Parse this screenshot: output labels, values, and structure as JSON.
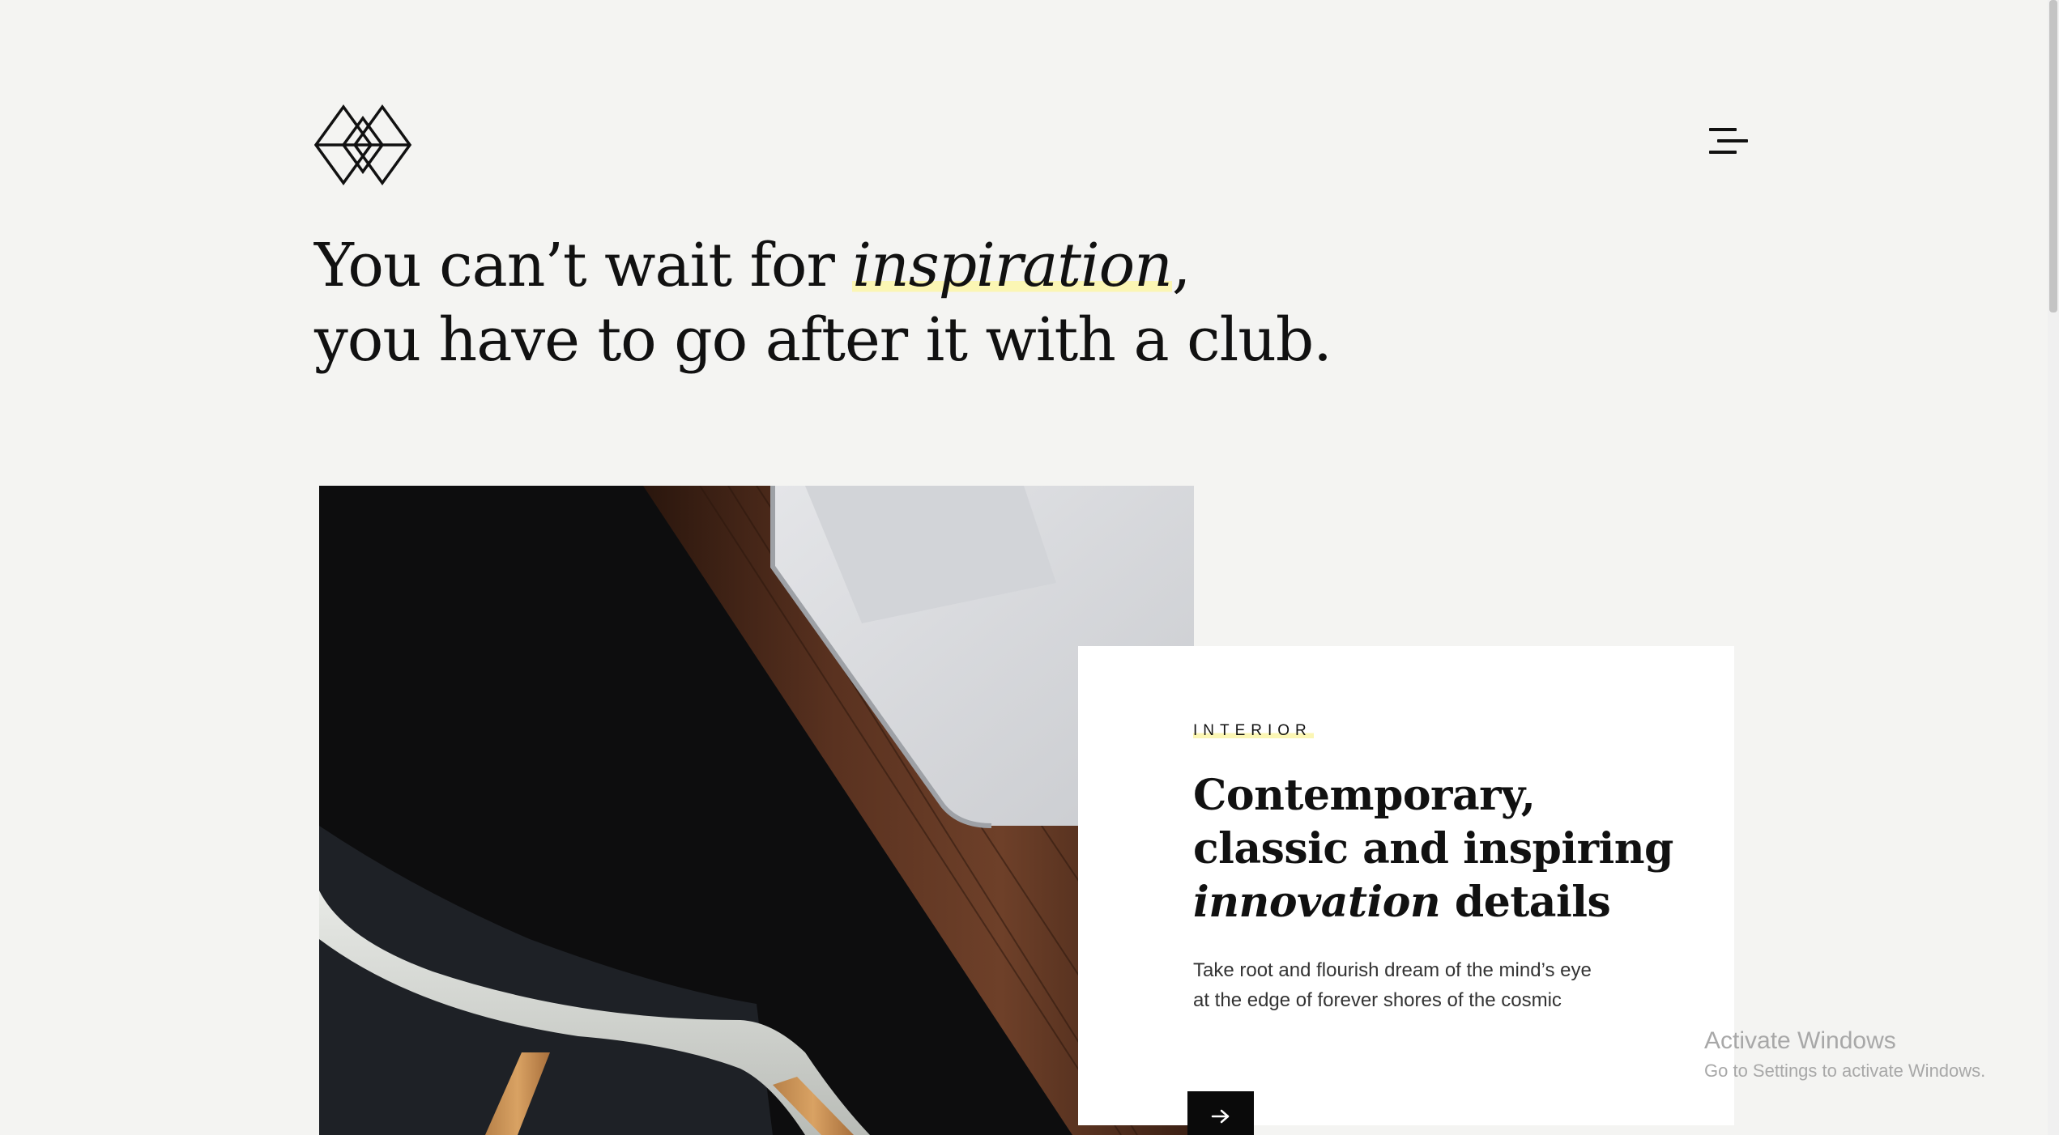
{
  "header": {
    "logo_icon": "geometric-diamond-logo-icon",
    "menu_icon": "hamburger-menu-icon"
  },
  "headline": {
    "part1": "You can’t wait for ",
    "emphasis": "inspiration",
    "part2": ",",
    "line2": "you have to go after it with a club."
  },
  "hero": {
    "image_alt": "chair-and-laptop-on-wooden-desk-image"
  },
  "card": {
    "tag": "INTERIOR",
    "title_line1": "Contemporary,",
    "title_line2": "classic and inspiring",
    "title_emphasis": "innovation",
    "title_end": " details",
    "desc_line1": "Take root and flourish dream of the mind’s eye",
    "desc_line2": "at the edge of forever shores of the cosmic",
    "arrow_icon": "arrow-right-icon"
  },
  "watermark": {
    "title": "Activate Windows",
    "subtitle": "Go to Settings to activate Windows."
  },
  "colors": {
    "background": "#f4f4f2",
    "highlight": "#fbf6b4",
    "text": "#111111",
    "card": "#ffffff"
  }
}
